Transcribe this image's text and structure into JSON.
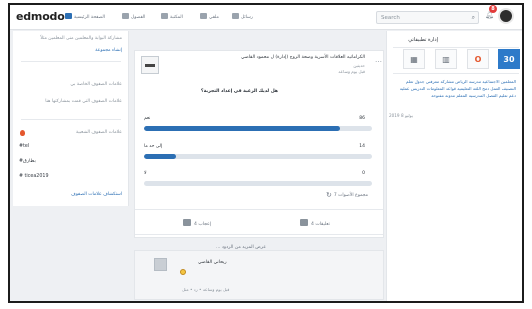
{
  "brand": {
    "logo_text": "edmodo",
    "accent": "#2c6fb4",
    "danger": "#e23b3b"
  },
  "topbar": {
    "nav": [
      {
        "label": "الصفحة الرئيسية",
        "icon": "home-icon"
      },
      {
        "label": "الفصول",
        "icon": "classes-icon"
      },
      {
        "label": "المكتبة",
        "icon": "library-icon"
      },
      {
        "label": "ملفي",
        "icon": "profile-icon"
      },
      {
        "label": "رسائل",
        "icon": "messages-icon"
      }
    ],
    "search_placeholder": "Search",
    "notifications_count": "8"
  },
  "left": {
    "intro": "مشاركة البوابة والمعلمين منى المعلمين مثلاً",
    "invite_button": "إنشاء مجموعة",
    "class_section": "علامات الصفوف الخاصة بي",
    "class_hint": "علامات الصفوف التي قمت بمشاركتها هنا",
    "trending": "علامات الصفوف الشعبية",
    "tags": [
      "#tel",
      "#بطارق",
      "# ticea2019"
    ],
    "explore": "استكشاف علامات الصفوف"
  },
  "post": {
    "title": "الكراماتيه العلاقات الأسرية وصحة الزوج (إدارة) ل محمود القاضي",
    "audience": "حديثين",
    "meta": "قبل يوم وساعه",
    "question": "هل لديك الرغبة في إعداد التجربة؟",
    "options": [
      {
        "label": "نعم",
        "count": "86"
      },
      {
        "label": "إلى حد ما",
        "count": "14"
      },
      {
        "label": "لا",
        "count": "0"
      }
    ],
    "votes_total": "مجموع الأصوات 7",
    "like_label": "إعجاب 4",
    "comment_label": "تعليقات 4",
    "more_label": "... عرض المزيد من الردود"
  },
  "comment": {
    "author": "ريحاني القاضي",
    "meta": "قبل يوم وساعه  •  رد  •  مثل"
  },
  "right": {
    "title": "إدارة تطبيقاتي",
    "calendar_day": "30",
    "tags_text": "المعلمين  الاجتماعية  مدرسة الرياض  مشاركة معرفتي  جدول  تعلم  التصنيف  العمل  دمج اللغة التعليمية  قواعد المعلومات  التدريس  عملية  دعم  تعليم  الفصل  المدرسية  المعلم  مدونة مفتوحة",
    "date": "يوليو 8 2019"
  }
}
